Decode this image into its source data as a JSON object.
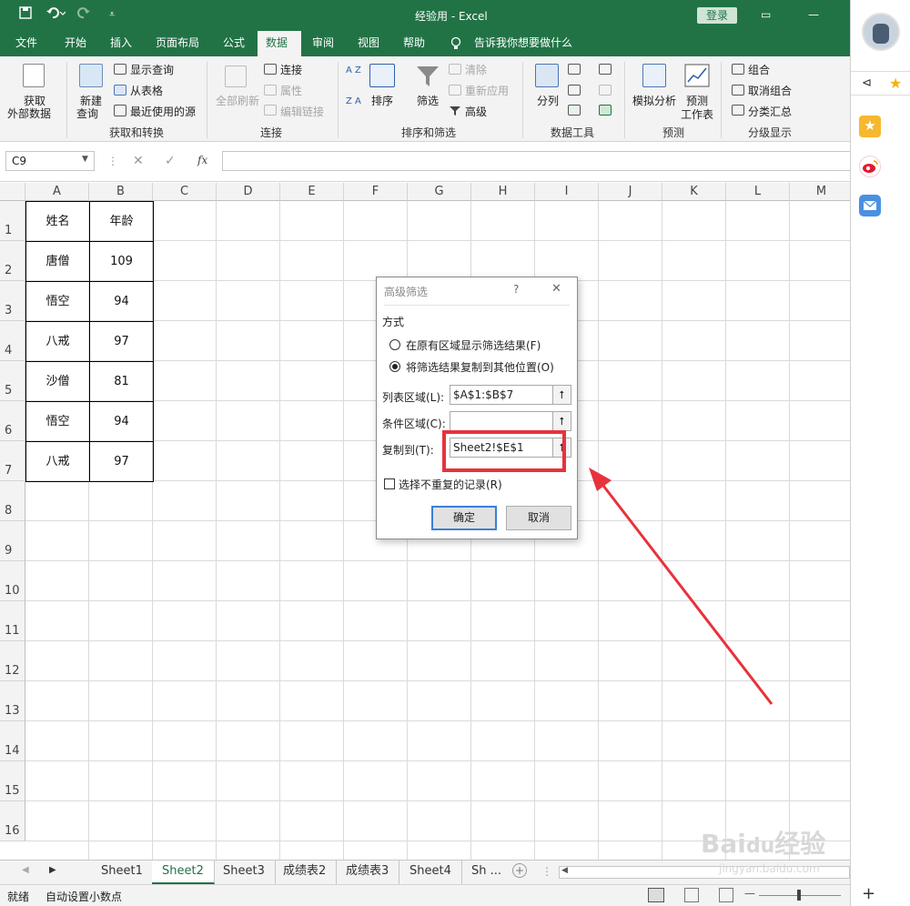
{
  "window": {
    "title": "经验用  -  Excel",
    "login_label": "登录",
    "title_icons": [
      "save-icon",
      "undo-icon",
      "redo-icon",
      "customize-qat-icon"
    ]
  },
  "tabs": [
    {
      "label": "文件",
      "active": false
    },
    {
      "label": "开始",
      "active": false
    },
    {
      "label": "插入",
      "active": false
    },
    {
      "label": "页面布局",
      "active": false
    },
    {
      "label": "公式",
      "active": false
    },
    {
      "label": "数据",
      "active": true
    },
    {
      "label": "审阅",
      "active": false
    },
    {
      "label": "视图",
      "active": false
    },
    {
      "label": "帮助",
      "active": false
    },
    {
      "label": "告诉我你想要做什么",
      "active": false
    }
  ],
  "ribbon": {
    "get_external": [
      "获取",
      "外部数据"
    ],
    "new_query": [
      "新建",
      "查询"
    ],
    "show_query": "显示查询",
    "from_table": "从表格",
    "recent_sources": "最近使用的源",
    "group_get_transform": "获取和转换",
    "refresh_all": "全部刷新",
    "connections": "连接",
    "properties": "属性",
    "edit_links": "编辑链接",
    "group_connections": "连接",
    "sort_label": "排序",
    "filter_label": "筛选",
    "clear_label": "清除",
    "reapply_label": "重新应用",
    "advanced_label": "高级",
    "group_sort_filter": "排序和筛选",
    "split_column": "分列",
    "group_data_tools": "数据工具",
    "what_if": "模拟分析",
    "forecast_sheet": [
      "预测",
      "工作表"
    ],
    "group_forecast": "预测",
    "group_label": "组合",
    "ungroup_label": "取消组合",
    "subtotal_label": "分类汇总",
    "group_outline": "分级显示",
    "sort_az": "A Z",
    "sort_za": "Z A"
  },
  "formula_bar": {
    "name_box": "C9",
    "fx": "fx",
    "cancel": "✕",
    "enter": "✓"
  },
  "columns": [
    "A",
    "B",
    "C",
    "D",
    "E",
    "F",
    "G",
    "H",
    "I",
    "J",
    "K",
    "L",
    "M"
  ],
  "rows": [
    "1",
    "2",
    "3",
    "4",
    "5",
    "6",
    "7",
    "8",
    "9",
    "10",
    "11",
    "12",
    "13",
    "14",
    "15",
    "16"
  ],
  "table": {
    "header": [
      "姓名",
      "年龄"
    ],
    "rows": [
      [
        "唐僧",
        "109"
      ],
      [
        "悟空",
        "94"
      ],
      [
        "八戒",
        "97"
      ],
      [
        "沙僧",
        "81"
      ],
      [
        "悟空",
        "94"
      ],
      [
        "八戒",
        "97"
      ]
    ]
  },
  "dialog": {
    "title": "高级筛选",
    "help": "?",
    "close": "✕",
    "section": "方式",
    "option1": "在原有区域显示筛选结果(F)",
    "option2": "将筛选结果复制到其他位置(O)",
    "list_range_label": "列表区域(L):",
    "list_range_value": "$A$1:$B$7",
    "criteria_range_label": "条件区域(C):",
    "criteria_range_value": "",
    "copy_to_label": "复制到(T):",
    "copy_to_value": "Sheet2!$E$1",
    "unique_label": "选择不重复的记录(R)",
    "ok": "确定",
    "cancel": "取消",
    "highlight_color": "#e8323c"
  },
  "sheet_tabs": [
    {
      "label": "Sheet1",
      "active": false
    },
    {
      "label": "Sheet2",
      "active": true
    },
    {
      "label": "Sheet3",
      "active": false
    },
    {
      "label": "成绩表2",
      "active": false
    },
    {
      "label": "成绩表3",
      "active": false
    },
    {
      "label": "Sheet4",
      "active": false
    },
    {
      "label": "Sh ...",
      "active": false
    }
  ],
  "status": {
    "ready": "就绪",
    "auto_decimal": "自动设置小数点"
  },
  "watermark": {
    "brand": "Bai",
    "text": "经验",
    "url": "jingyan.baidu.com"
  },
  "colors": {
    "excel_green": "#217346",
    "arrow_red": "#e8323c"
  }
}
